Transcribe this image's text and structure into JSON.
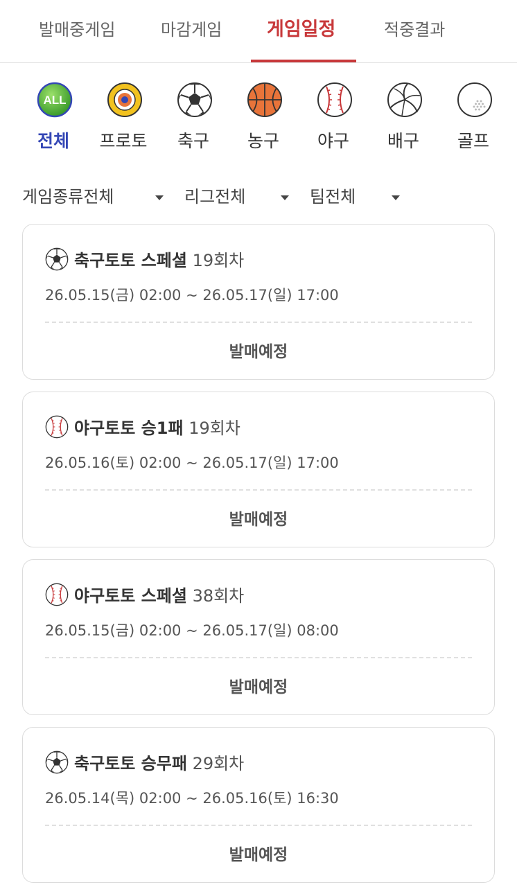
{
  "tabs": [
    {
      "label": "발매중게임"
    },
    {
      "label": "마감게임"
    },
    {
      "label": "게임일정"
    },
    {
      "label": "적중결과"
    }
  ],
  "categories": [
    {
      "label": "전체",
      "icon": "all-icon",
      "icon_text": "ALL"
    },
    {
      "label": "프로토",
      "icon": "target-icon"
    },
    {
      "label": "축구",
      "icon": "soccer-ball-icon"
    },
    {
      "label": "농구",
      "icon": "basketball-icon"
    },
    {
      "label": "야구",
      "icon": "baseball-icon"
    },
    {
      "label": "배구",
      "icon": "volleyball-icon"
    },
    {
      "label": "골프",
      "icon": "golf-ball-icon"
    }
  ],
  "filters": [
    {
      "label": "게임종류전체"
    },
    {
      "label": "리그전체"
    },
    {
      "label": "팀전체"
    }
  ],
  "games": [
    {
      "icon": "soccer-ball-icon",
      "name": "축구토토 스페셜",
      "round": "19회차",
      "date": "26.05.15(금) 02:00 ~ 26.05.17(일) 17:00",
      "status": "발매예정"
    },
    {
      "icon": "baseball-icon",
      "name": "야구토토 승1패",
      "round": "19회차",
      "date": "26.05.16(토) 02:00 ~ 26.05.17(일) 17:00",
      "status": "발매예정"
    },
    {
      "icon": "baseball-icon",
      "name": "야구토토 스페셜",
      "round": "38회차",
      "date": "26.05.15(금) 02:00 ~ 26.05.17(일) 08:00",
      "status": "발매예정"
    },
    {
      "icon": "soccer-ball-icon",
      "name": "축구토토 승무패",
      "round": "29회차",
      "date": "26.05.14(목) 02:00 ~ 26.05.16(토) 16:30",
      "status": "발매예정"
    }
  ],
  "colors": {
    "accent": "#c8383a",
    "active_category": "#3346b5"
  }
}
